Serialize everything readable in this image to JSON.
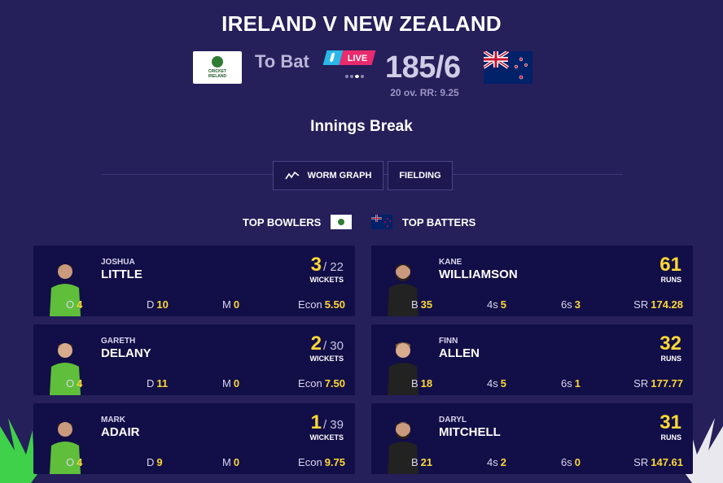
{
  "match": {
    "title": "IRELAND V NEW ZEALAND",
    "to_bat_label": "To Bat",
    "live_label": "LIVE",
    "score": "185/6",
    "overs_rr": "20 ov. RR: 9.25",
    "status": "Innings Break",
    "ireland_logo_text_1": "CRICKET",
    "ireland_logo_text_2": "IRELAND"
  },
  "tabs": {
    "worm_graph": "WORM GRAPH",
    "fielding": "FIELDING"
  },
  "sections": {
    "top_bowlers": "TOP BOWLERS",
    "top_batters": "TOP BATTERS"
  },
  "colors": {
    "background": "#251f5a",
    "card": "#120e47",
    "highlight": "#fdd835",
    "live": "#e92b6e",
    "ireland_kit": "#5fbf3a",
    "nz_kit": "#222222"
  },
  "bowlers": [
    {
      "first": "JOSHUA",
      "last": "LITTLE",
      "figure": "3",
      "of": "/ 22",
      "unit": "WICKETS",
      "stats": [
        {
          "label": "O",
          "value": "4"
        },
        {
          "label": "D",
          "value": "10"
        },
        {
          "label": "M",
          "value": "0"
        },
        {
          "label": "Econ",
          "value": "5.50"
        }
      ]
    },
    {
      "first": "GARETH",
      "last": "DELANY",
      "figure": "2",
      "of": "/ 30",
      "unit": "WICKETS",
      "stats": [
        {
          "label": "O",
          "value": "4"
        },
        {
          "label": "D",
          "value": "11"
        },
        {
          "label": "M",
          "value": "0"
        },
        {
          "label": "Econ",
          "value": "7.50"
        }
      ]
    },
    {
      "first": "MARK",
      "last": "ADAIR",
      "figure": "1",
      "of": "/ 39",
      "unit": "WICKETS",
      "stats": [
        {
          "label": "O",
          "value": "4"
        },
        {
          "label": "D",
          "value": "9"
        },
        {
          "label": "M",
          "value": "0"
        },
        {
          "label": "Econ",
          "value": "9.75"
        }
      ]
    }
  ],
  "batters": [
    {
      "first": "KANE",
      "last": "WILLIAMSON",
      "figure": "61",
      "unit": "RUNS",
      "stats": [
        {
          "label": "B",
          "value": "35"
        },
        {
          "label": "4s",
          "value": "5"
        },
        {
          "label": "6s",
          "value": "3"
        },
        {
          "label": "SR",
          "value": "174.28"
        }
      ]
    },
    {
      "first": "FINN",
      "last": "ALLEN",
      "figure": "32",
      "unit": "RUNS",
      "stats": [
        {
          "label": "B",
          "value": "18"
        },
        {
          "label": "4s",
          "value": "5"
        },
        {
          "label": "6s",
          "value": "1"
        },
        {
          "label": "SR",
          "value": "177.77"
        }
      ]
    },
    {
      "first": "DARYL",
      "last": "MITCHELL",
      "figure": "31",
      "unit": "RUNS",
      "stats": [
        {
          "label": "B",
          "value": "21"
        },
        {
          "label": "4s",
          "value": "2"
        },
        {
          "label": "6s",
          "value": "0"
        },
        {
          "label": "SR",
          "value": "147.61"
        }
      ]
    }
  ]
}
